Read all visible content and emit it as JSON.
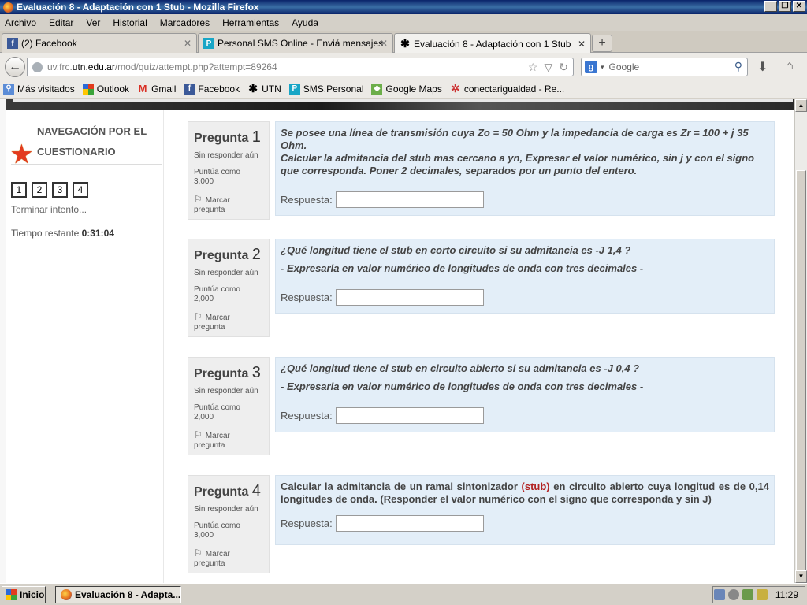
{
  "window": {
    "title": "Evaluación 8 - Adaptación con 1 Stub - Mozilla Firefox"
  },
  "menu": [
    "Archivo",
    "Editar",
    "Ver",
    "Historial",
    "Marcadores",
    "Herramientas",
    "Ayuda"
  ],
  "tabs": [
    {
      "label": "(2) Facebook"
    },
    {
      "label": "Personal SMS Online - Enviá mensajes SM..."
    },
    {
      "label": "Evaluación 8 - Adaptación con 1 Stub"
    }
  ],
  "nav": {
    "url_prefix": "uv.frc.",
    "url_domain": "utn.edu.ar",
    "url_path": "/mod/quiz/attempt.php?attempt=89264",
    "search_placeholder": "Google"
  },
  "bookmarks": [
    "Más visitados",
    "Outlook",
    "Gmail",
    "Facebook",
    "UTN",
    "SMS.Personal",
    "Google Maps",
    "conectarigualdad - Re..."
  ],
  "quiz_nav": {
    "title_line1": "NAVEGACIÓN POR EL",
    "title_line2": "CUESTIONARIO",
    "buttons": [
      "1",
      "2",
      "3",
      "4"
    ],
    "finish": "Terminar intento...",
    "timer_label": "Tiempo restante",
    "timer_value": "0:31:04"
  },
  "questions": [
    {
      "label": "Pregunta",
      "number": "1",
      "state": "Sin responder aún",
      "grade_label": "Puntúa como",
      "grade": "3,000",
      "flag_line1": "Marcar",
      "flag_line2": "pregunta",
      "text1": "Se posee una línea de transmisión cuya Zo = 50 Ohm y la impedancia de carga es Zr = 100 + j 35 Ohm.",
      "text2": "Calcular la admitancia del stub mas cercano a yn, Expresar el valor numérico, sin j y con el signo que corresponda. Poner 2 decimales, separados por un punto del entero.",
      "answer_label": "Respuesta:",
      "answer_value": ""
    },
    {
      "label": "Pregunta",
      "number": "2",
      "state": "Sin responder aún",
      "grade_label": "Puntúa como",
      "grade": "2,000",
      "flag_line1": "Marcar",
      "flag_line2": "pregunta",
      "text1": "¿Qué longitud tiene el stub en corto circuito si su admitancia es -J 1,4 ?",
      "text2": "- Expresarla en valor numérico de longitudes de onda con tres decimales -",
      "answer_label": "Respuesta:",
      "answer_value": ""
    },
    {
      "label": "Pregunta",
      "number": "3",
      "state": "Sin responder aún",
      "grade_label": "Puntúa como",
      "grade": "2,000",
      "flag_line1": "Marcar",
      "flag_line2": "pregunta",
      "text1": "¿Qué longitud tiene el stub en circuito abierto si su admitancia es -J 0,4 ?",
      "text2": "- Expresarla en valor numérico de longitudes de onda con tres decimales -",
      "answer_label": "Respuesta:",
      "answer_value": ""
    },
    {
      "label": "Pregunta",
      "number": "4",
      "state": "Sin responder aún",
      "grade_label": "Puntúa como",
      "grade": "3,000",
      "flag_line1": "Marcar",
      "flag_line2": "pregunta",
      "text_a": "Calcular la admitancia de un ramal sintonizador",
      "text_stub": "(stub)",
      "text_b": "en circuito abierto cuya longitud es de 0,14 longitudes de onda. (Responder el valor numérico con el signo que corresponda y sin J)",
      "answer_label": "Respuesta:",
      "answer_value": ""
    }
  ],
  "taskbar": {
    "start": "Inicio",
    "item": "Evaluación 8 - Adapta...",
    "clock": "11:29"
  }
}
